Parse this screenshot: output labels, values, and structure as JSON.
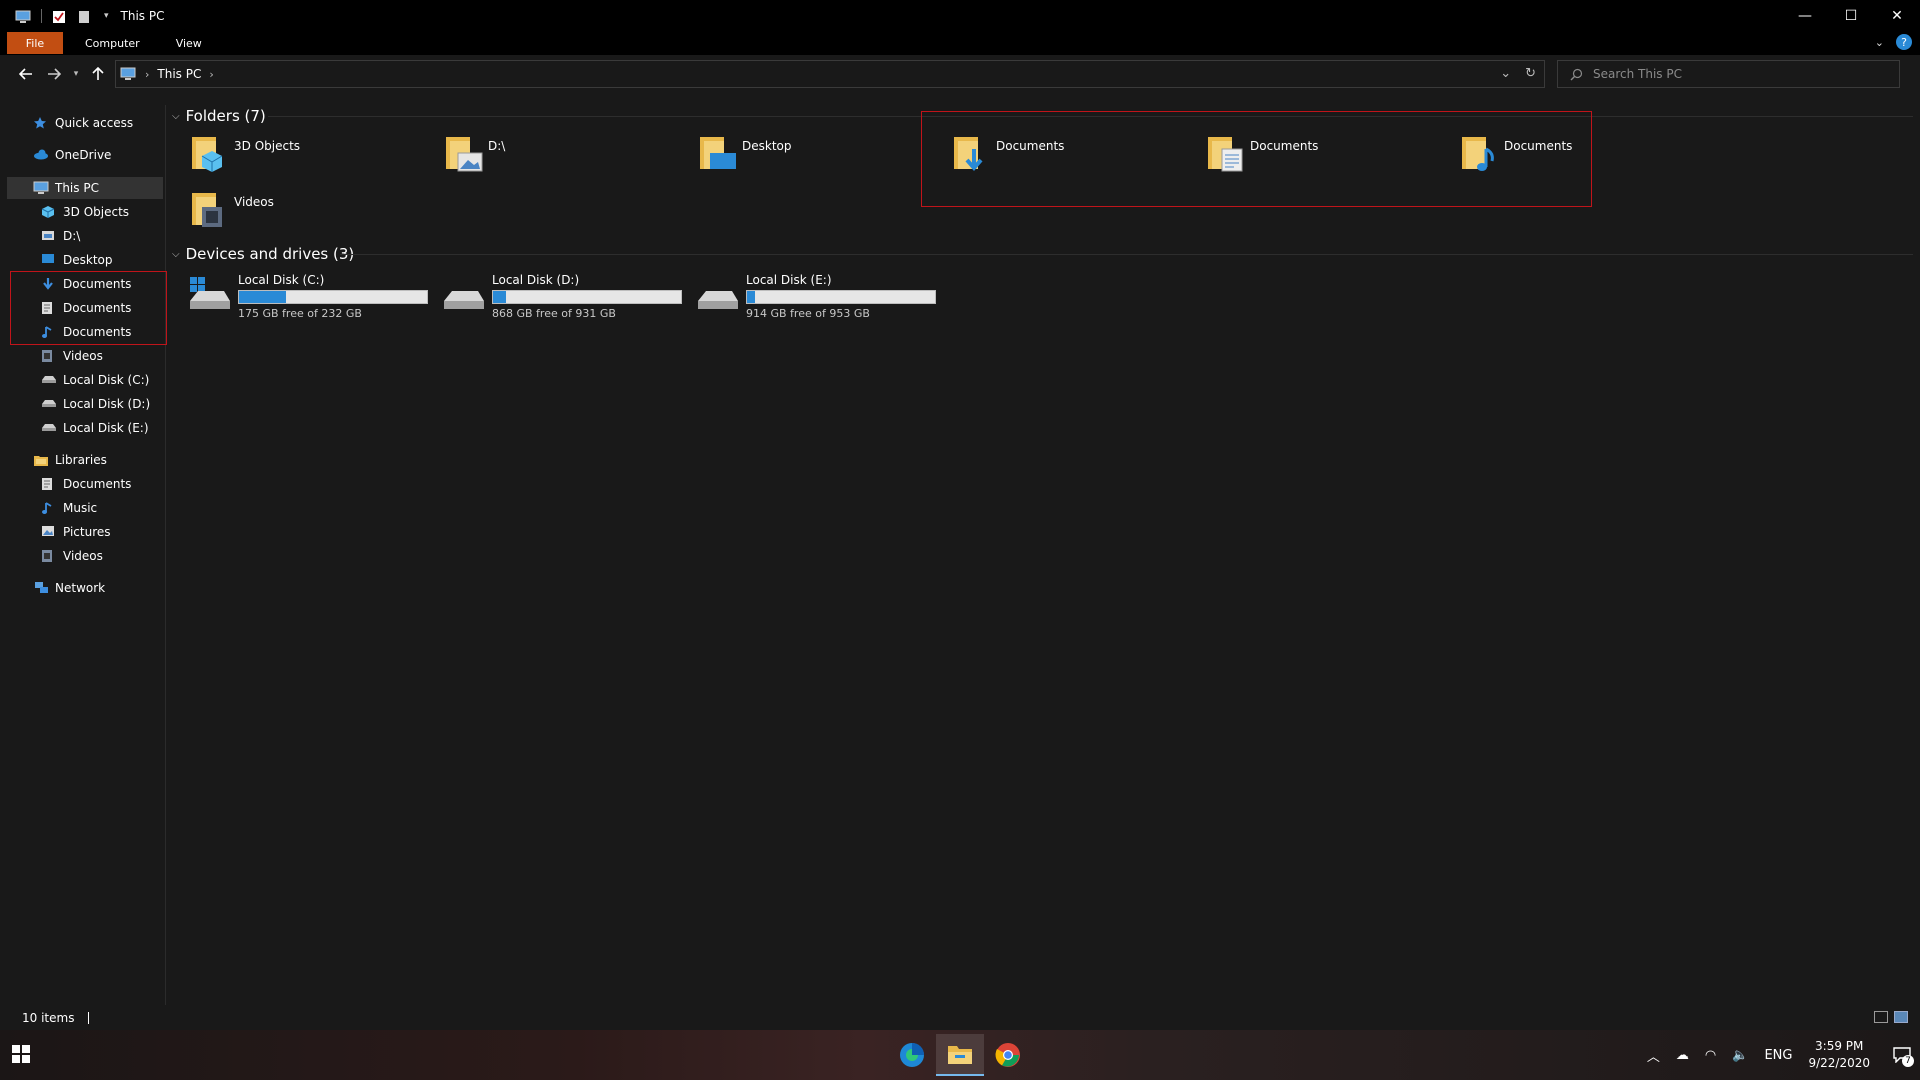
{
  "window": {
    "title": "This PC",
    "controls": {
      "minimize": "—",
      "maximize": "☐",
      "close": "✕"
    }
  },
  "ribbon": {
    "tabs": [
      "File",
      "Computer",
      "View"
    ],
    "help": "?"
  },
  "address": {
    "crumbs": [
      "This PC"
    ],
    "search_placeholder": "Search This PC"
  },
  "sidebar": {
    "items": [
      {
        "label": "Quick access",
        "icon": "star-icon"
      },
      {
        "label": "OneDrive",
        "icon": "cloud-icon"
      },
      {
        "label": "This PC",
        "icon": "computer-icon"
      },
      {
        "label": "3D Objects",
        "icon": "cube-icon"
      },
      {
        "label": "D:\\",
        "icon": "drive-folder-icon"
      },
      {
        "label": "Desktop",
        "icon": "desktop-icon"
      },
      {
        "label": "Documents",
        "icon": "download-icon"
      },
      {
        "label": "Documents",
        "icon": "document-icon"
      },
      {
        "label": "Documents",
        "icon": "music-note-icon"
      },
      {
        "label": "Videos",
        "icon": "film-icon"
      },
      {
        "label": "Local Disk (C:)",
        "icon": "disk-icon"
      },
      {
        "label": "Local Disk (D:)",
        "icon": "disk-icon"
      },
      {
        "label": "Local Disk (E:)",
        "icon": "disk-icon"
      },
      {
        "label": "Libraries",
        "icon": "library-icon"
      },
      {
        "label": "Documents",
        "icon": "document-icon"
      },
      {
        "label": "Music",
        "icon": "music-note-icon"
      },
      {
        "label": "Pictures",
        "icon": "picture-icon"
      },
      {
        "label": "Videos",
        "icon": "film-icon"
      },
      {
        "label": "Network",
        "icon": "network-icon"
      }
    ]
  },
  "content": {
    "folders_header": "Folders (7)",
    "folders": [
      {
        "label": "3D Objects",
        "icon": "cube-icon"
      },
      {
        "label": "D:\\",
        "icon": "picture-icon"
      },
      {
        "label": "Desktop",
        "icon": "desktop-icon"
      },
      {
        "label": "Documents",
        "icon": "download-icon"
      },
      {
        "label": "Documents",
        "icon": "document-icon"
      },
      {
        "label": "Documents",
        "icon": "music-note-icon"
      },
      {
        "label": "Videos",
        "icon": "film-icon"
      }
    ],
    "drives_header": "Devices and drives (3)",
    "drives": [
      {
        "name": "Local Disk (C:)",
        "free": "175 GB free of 232 GB",
        "used_fraction": 0.25
      },
      {
        "name": "Local Disk (D:)",
        "free": "868 GB free of 931 GB",
        "used_fraction": 0.07
      },
      {
        "name": "Local Disk (E:)",
        "free": "914 GB free of 953 GB",
        "used_fraction": 0.04
      }
    ]
  },
  "statusbar": {
    "count": "10 items"
  },
  "taskbar": {
    "apps": [
      "edge-icon",
      "file-explorer-icon",
      "chrome-icon"
    ],
    "language": "ENG",
    "time": "3:59 PM",
    "date": "9/22/2020",
    "notification_count": "7"
  },
  "colors": {
    "accent": "#2a8ad6",
    "file_tab": "#c24e12",
    "highlight": "#c0141a",
    "folder": "#e8b84a"
  }
}
